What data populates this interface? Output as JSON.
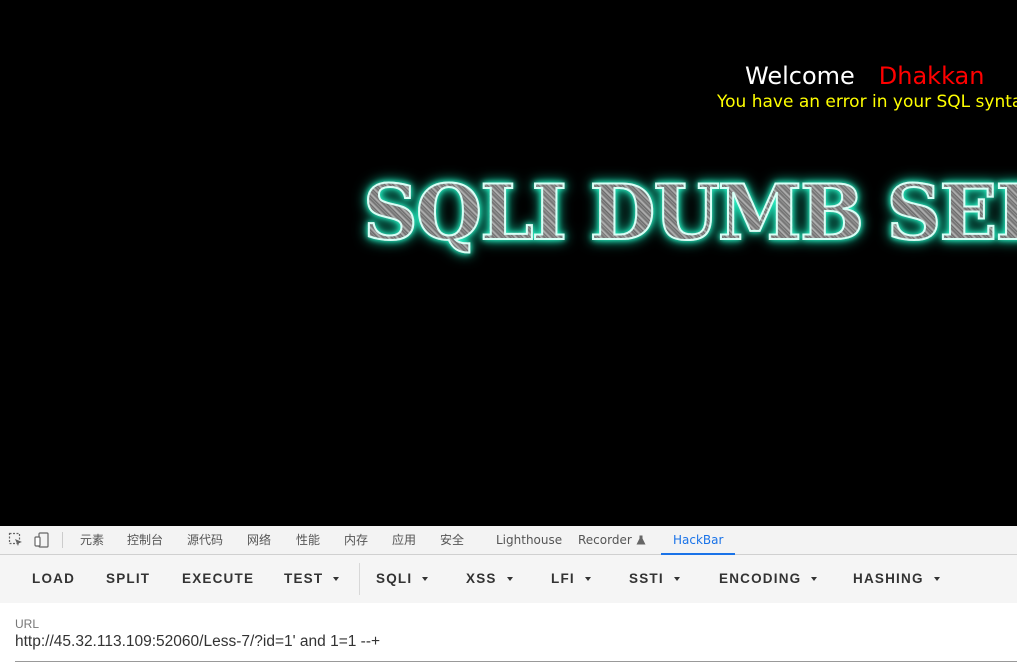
{
  "page": {
    "welcome": "Welcome",
    "username": "Dhakkan",
    "error_message": "You have an error in your SQL syntax",
    "banner": "SQLI DUMB SERIES"
  },
  "devtools": {
    "tabs": [
      "元素",
      "控制台",
      "源代码",
      "网络",
      "性能",
      "内存",
      "应用",
      "安全",
      "Lighthouse",
      "Recorder",
      "HackBar"
    ],
    "active_tab": "HackBar",
    "accent_color": "#1a73e8"
  },
  "hackbar": {
    "buttons": {
      "load": "LOAD",
      "split": "SPLIT",
      "execute": "EXECUTE",
      "test": "TEST",
      "sqli": "SQLI",
      "xss": "XSS",
      "lfi": "LFI",
      "ssti": "SSTI",
      "encoding": "ENCODING",
      "hashing": "HASHING"
    },
    "url_label": "URL",
    "url_value": "http://45.32.113.109:52060/Less-7/?id=1' and 1=1 --+"
  },
  "colors": {
    "welcome": "#ffffff",
    "username": "#ff0000",
    "error": "#ffff00",
    "banner_glow": "#2fffd0"
  }
}
